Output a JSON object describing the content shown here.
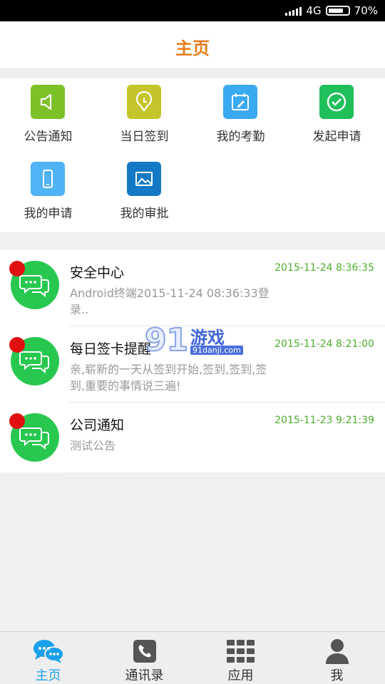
{
  "status": {
    "network": "4G",
    "battery": "70%"
  },
  "header": {
    "title": "主页"
  },
  "quick": [
    {
      "label": "公告通知",
      "icon": "speaker-icon",
      "color": "#7cc127"
    },
    {
      "label": "当日签到",
      "icon": "clock-pin-icon",
      "color": "#c5c42a"
    },
    {
      "label": "我的考勤",
      "icon": "calendar-edit-icon",
      "color": "#3aa9f0"
    },
    {
      "label": "发起申请",
      "icon": "check-circle-icon",
      "color": "#1fbf5a"
    },
    {
      "label": "我的申请",
      "icon": "phone-icon",
      "color": "#4fb3f5"
    },
    {
      "label": "我的审批",
      "icon": "image-icon",
      "color": "#1479c4"
    }
  ],
  "messages": [
    {
      "title": "安全中心",
      "time": "2015-11-24 8:36:35",
      "body": "Android终端2015-11-24 08:36:33登录.."
    },
    {
      "title": "每日签卡提醒",
      "time": "2015-11-24 8:21:00",
      "body": "亲,崭新的一天从签到开始,签到,签到,签到,重要的事情说三遍!"
    },
    {
      "title": "公司通知",
      "time": "2015-11-23 9:21:39",
      "body": "测试公告"
    }
  ],
  "watermark": {
    "number": "91",
    "text": "游戏",
    "url": "91danji.com"
  },
  "nav": [
    {
      "label": "主页",
      "icon": "chat-bubbles-icon",
      "active": true
    },
    {
      "label": "通讯录",
      "icon": "phone-handset-icon",
      "active": false
    },
    {
      "label": "应用",
      "icon": "grid-icon",
      "active": false
    },
    {
      "label": "我",
      "icon": "person-icon",
      "active": false
    }
  ],
  "colors": {
    "accent_orange": "#e87b17",
    "time_green": "#4cae2c",
    "nav_active": "#1aa0e8",
    "avatar_green": "#28c850",
    "unread_red": "#e01010"
  }
}
